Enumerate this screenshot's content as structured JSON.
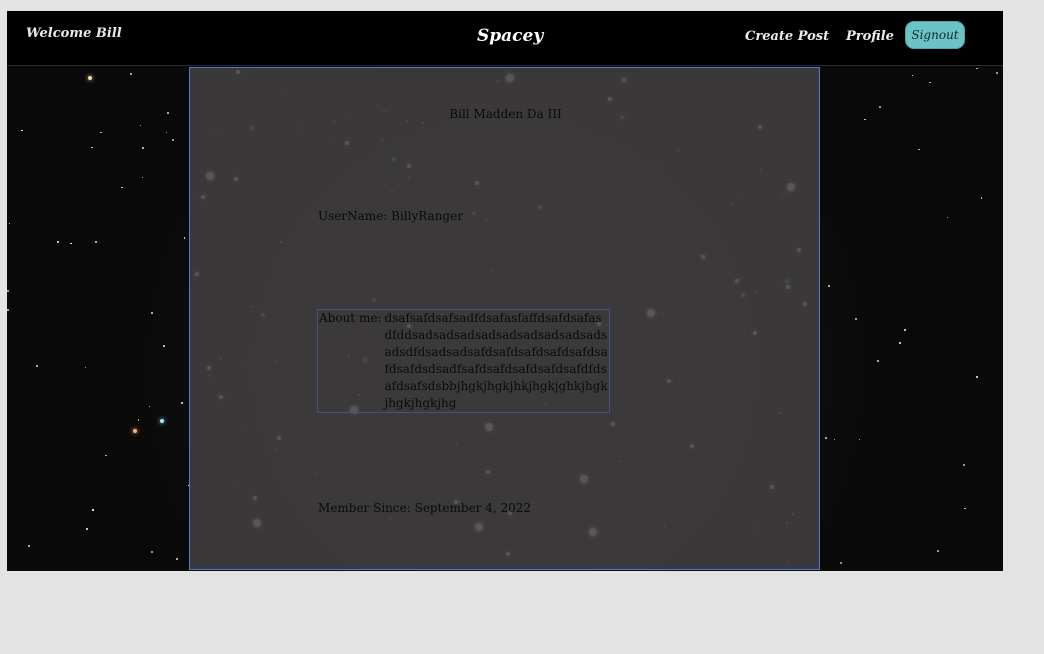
{
  "navbar": {
    "welcome": "Welcome Bill",
    "brand": "Spacey",
    "create_post": "Create Post",
    "profile": "Profile",
    "signout": "Signout"
  },
  "profile": {
    "name": "Bill Madden Da III",
    "username_label": "UserName:",
    "username": "BillyRanger",
    "about_label": "About me:",
    "about": "dsafsafdsafsadfdsafasfaffdsafdsafasdfddsadsadsadsadsadsadsadsadsadsadsdfdsadsadsafdsafdsafdsafdsafdsafdsafdsdsadfsafdsafdsafdsafdsafdfdsafdsafsdsbbjhgkjhgkjhkjhgkjghkjhgkjhgkjhgkjhg",
    "member_label": "Member Since:",
    "member_since": "September 4, 2022"
  },
  "colors": {
    "navbar_bg": "#000000",
    "signout_bg": "#6cc3c5",
    "card_bg": "#3e3c3c",
    "card_border": "#4d7bd2"
  }
}
